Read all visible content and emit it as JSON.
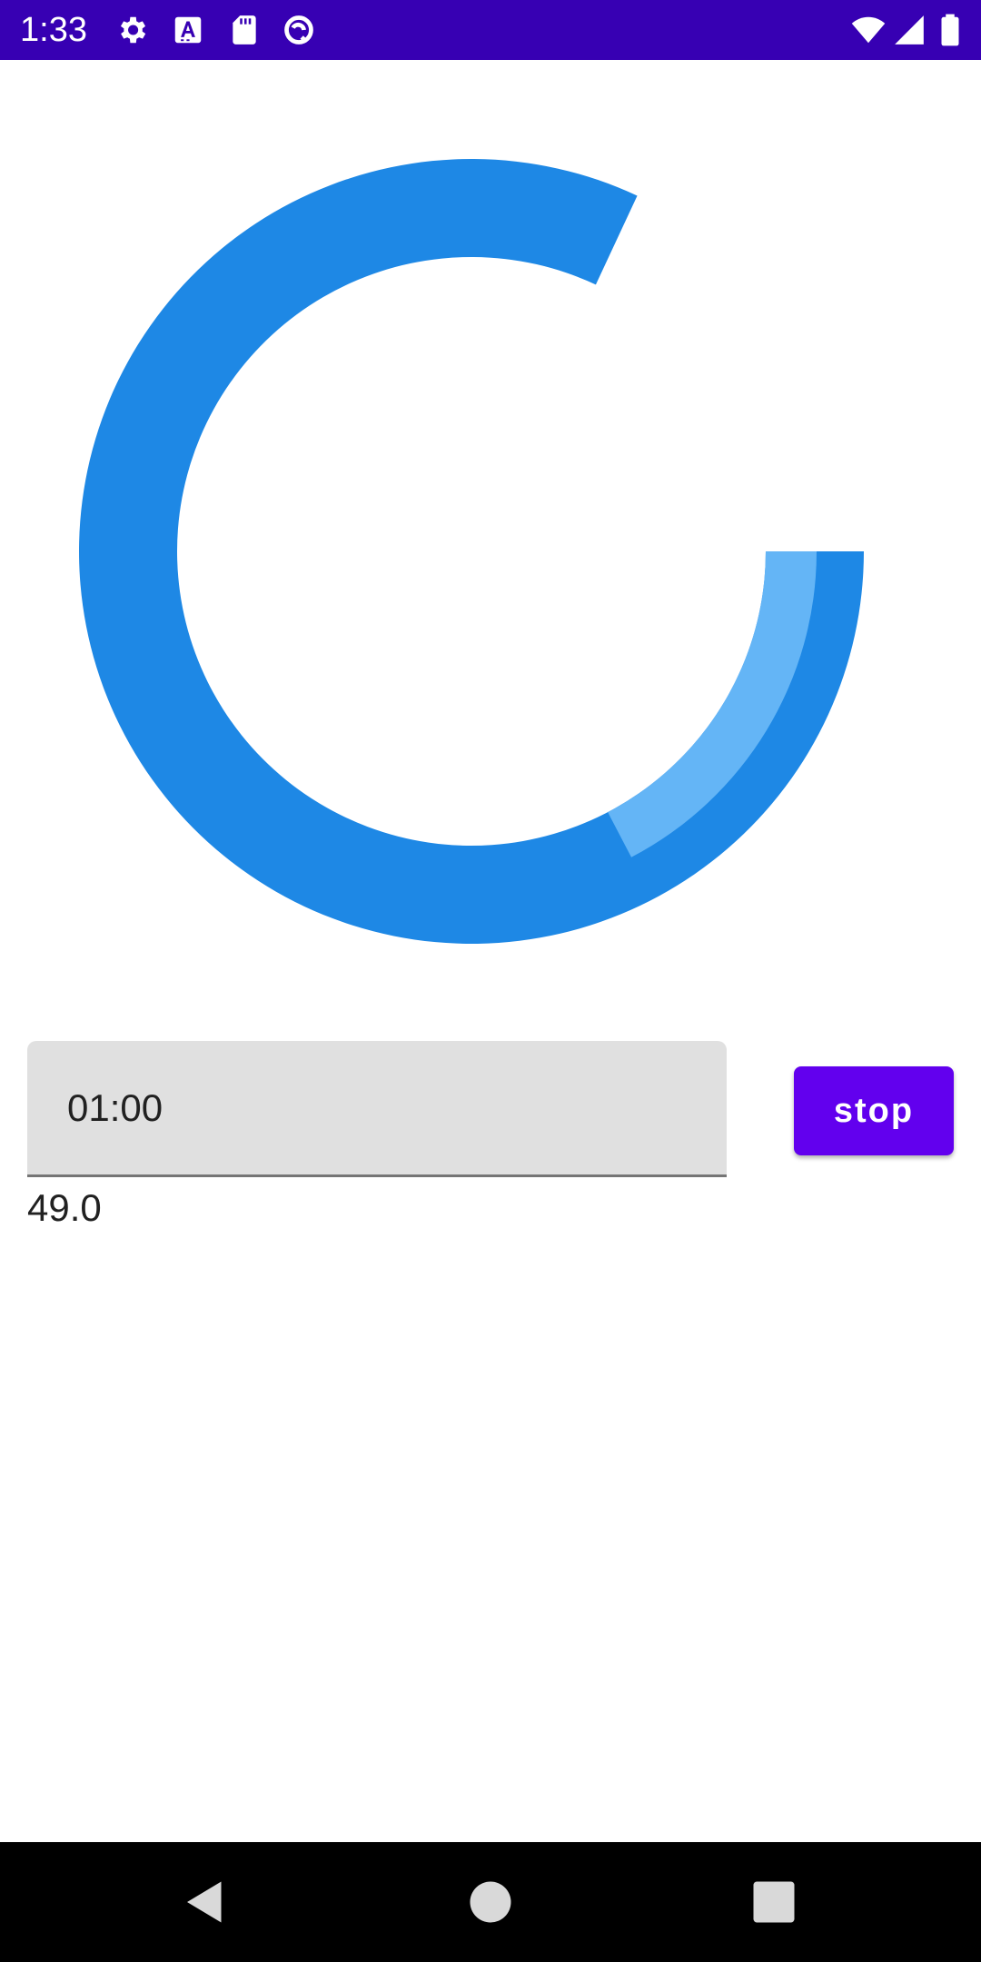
{
  "status_bar": {
    "time": "1:33",
    "background_color": "#3700b3",
    "left_icons": [
      "gear-icon",
      "font-a-icon",
      "sd-card-icon",
      "sync-circle-icon"
    ],
    "right_icons": [
      "wifi-icon",
      "cell-signal-icon",
      "battery-icon"
    ]
  },
  "timer": {
    "ring_color": "#1e88e5",
    "progress_color": "#64b5f6",
    "gap_color": "#ffffff",
    "progress_fraction": 0.17
  },
  "time_input": {
    "value": "01:00"
  },
  "stop_button": {
    "label": "stop",
    "color": "#6200ee"
  },
  "remaining": {
    "value": "49.0"
  },
  "nav_bar": {
    "icons": [
      "back-icon",
      "home-icon",
      "recents-icon"
    ]
  }
}
